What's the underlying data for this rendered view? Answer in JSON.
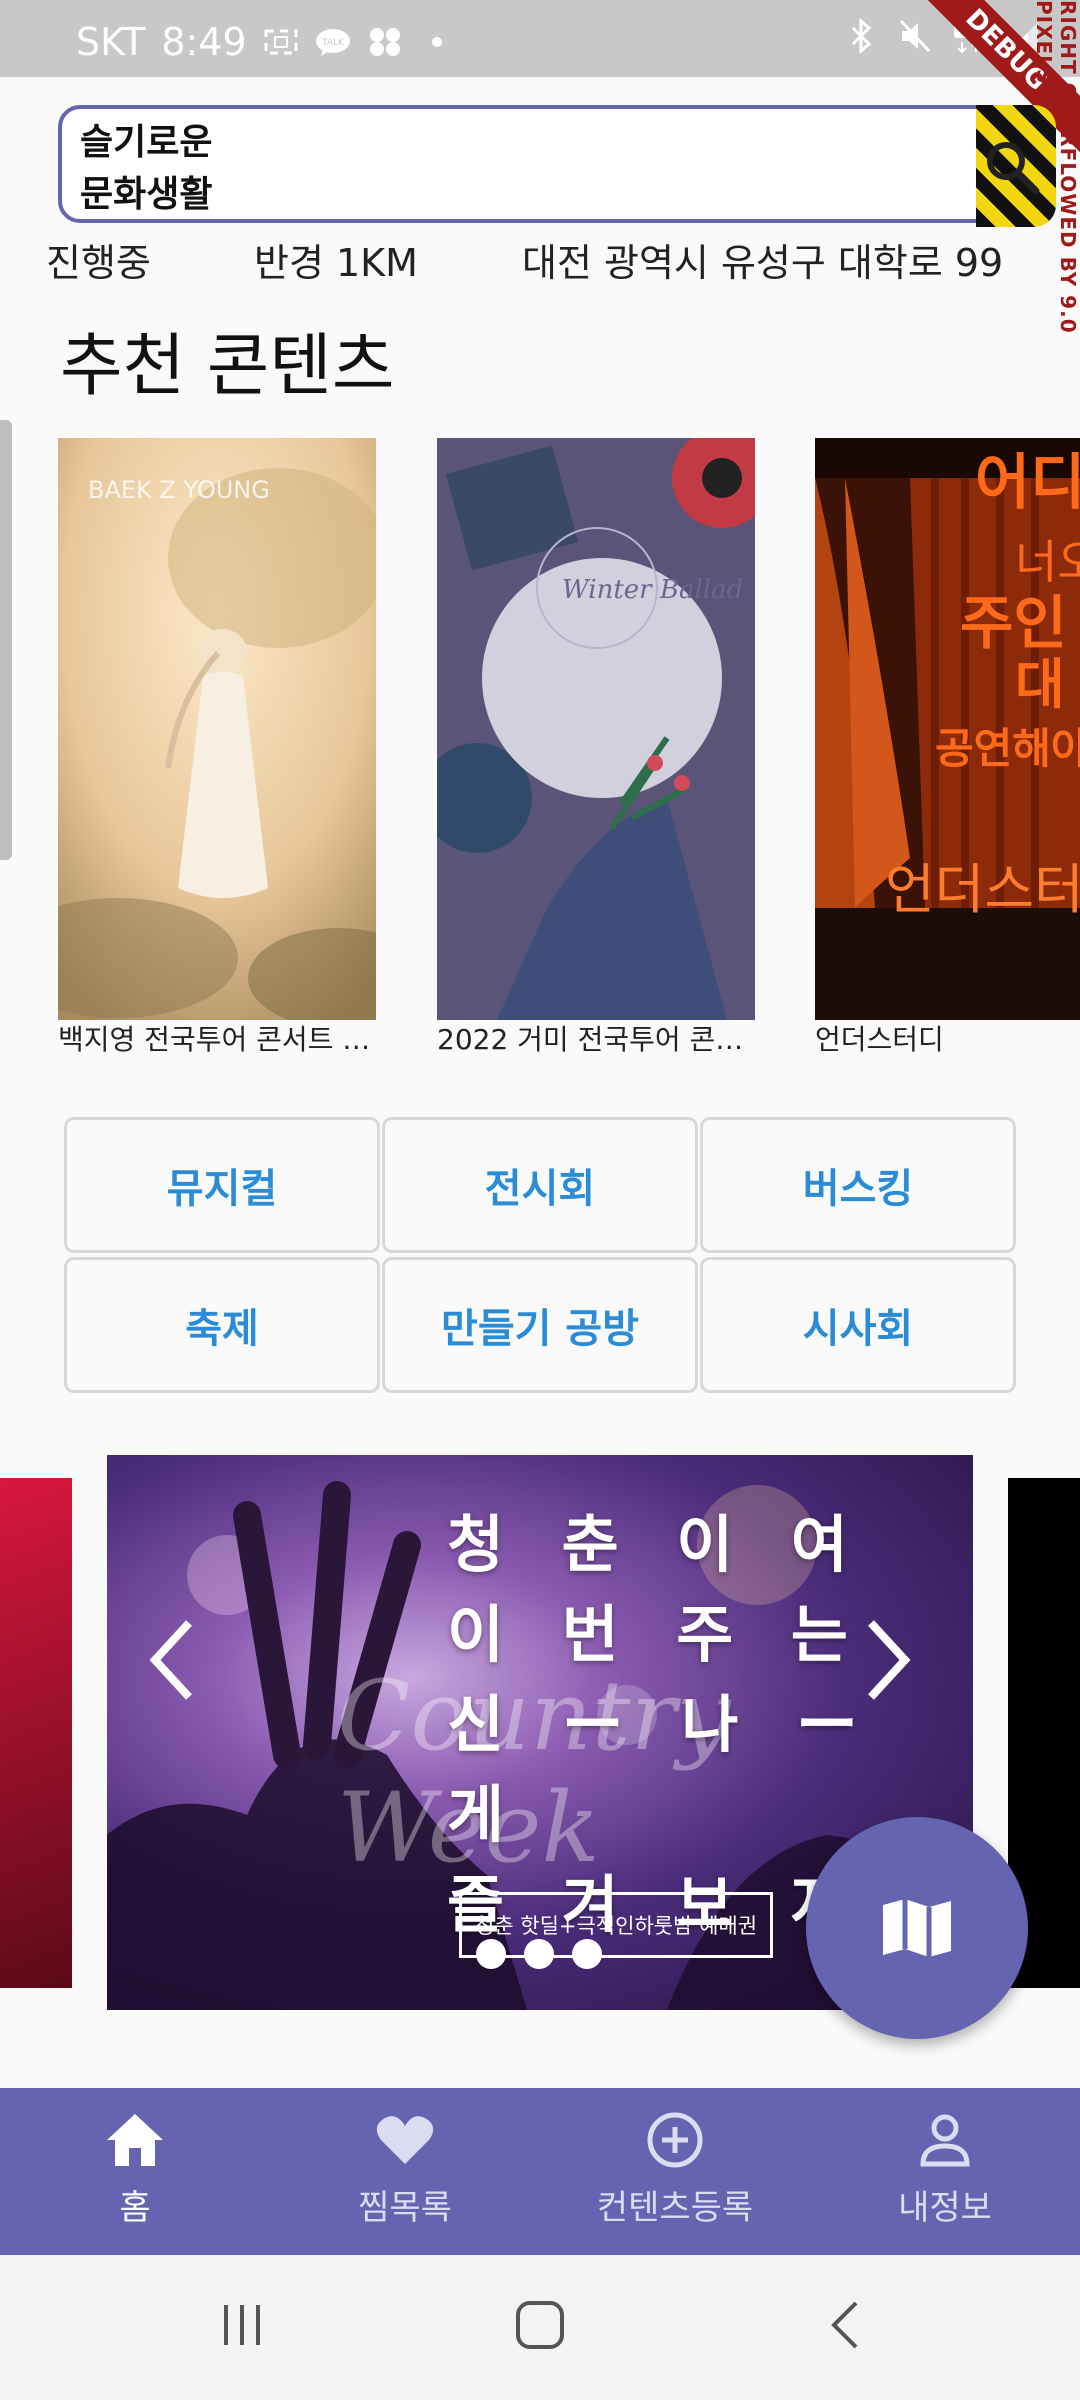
{
  "status_bar": {
    "carrier": "SKT",
    "time": "8:49",
    "debug_banner": "DEBUG",
    "overflow_warning": "RIGHT OVERFLOWED BY 9.0 PIXELS"
  },
  "app": {
    "logo_line1": "슬기로운",
    "logo_line2": "문화생활"
  },
  "filters": {
    "status": "진행중",
    "radius": "반경 1KM",
    "address": "대전 광역시 유성구 대학로 99"
  },
  "recommended": {
    "title": "추천 콘텐츠",
    "items": [
      {
        "caption": "백지영 전국투어 콘서트 …",
        "poster_text": "BAEK Z YOUNG"
      },
      {
        "caption": "2022 거미 전국투어 콘…",
        "poster_text": "Winter Ballad"
      },
      {
        "caption": "언더스터디",
        "poster_text": "언더스터디"
      }
    ]
  },
  "categories": [
    "뮤지컬",
    "전시회",
    "버스킹",
    "축제",
    "만들기 공방",
    "시사회"
  ],
  "banner": {
    "headline_lines": [
      "청 춘 이 여",
      "이 번 주 는",
      "신 ー 나 ー 게",
      "즐 겨 보 자 !"
    ],
    "script_text": "Country Week",
    "ticket_text": "청춘 핫딜+극적인하룻밤 예매권"
  },
  "bottom_nav": [
    {
      "label": "홈",
      "icon": "home-icon",
      "active": true
    },
    {
      "label": "찜목록",
      "icon": "heart-icon",
      "active": false
    },
    {
      "label": "컨텐츠등록",
      "icon": "add-circle-icon",
      "active": false
    },
    {
      "label": "내정보",
      "icon": "person-icon",
      "active": false
    }
  ],
  "colors": {
    "primary": "#6464b0",
    "category_text": "#2a8bd6",
    "debug": "#a01a1a"
  }
}
